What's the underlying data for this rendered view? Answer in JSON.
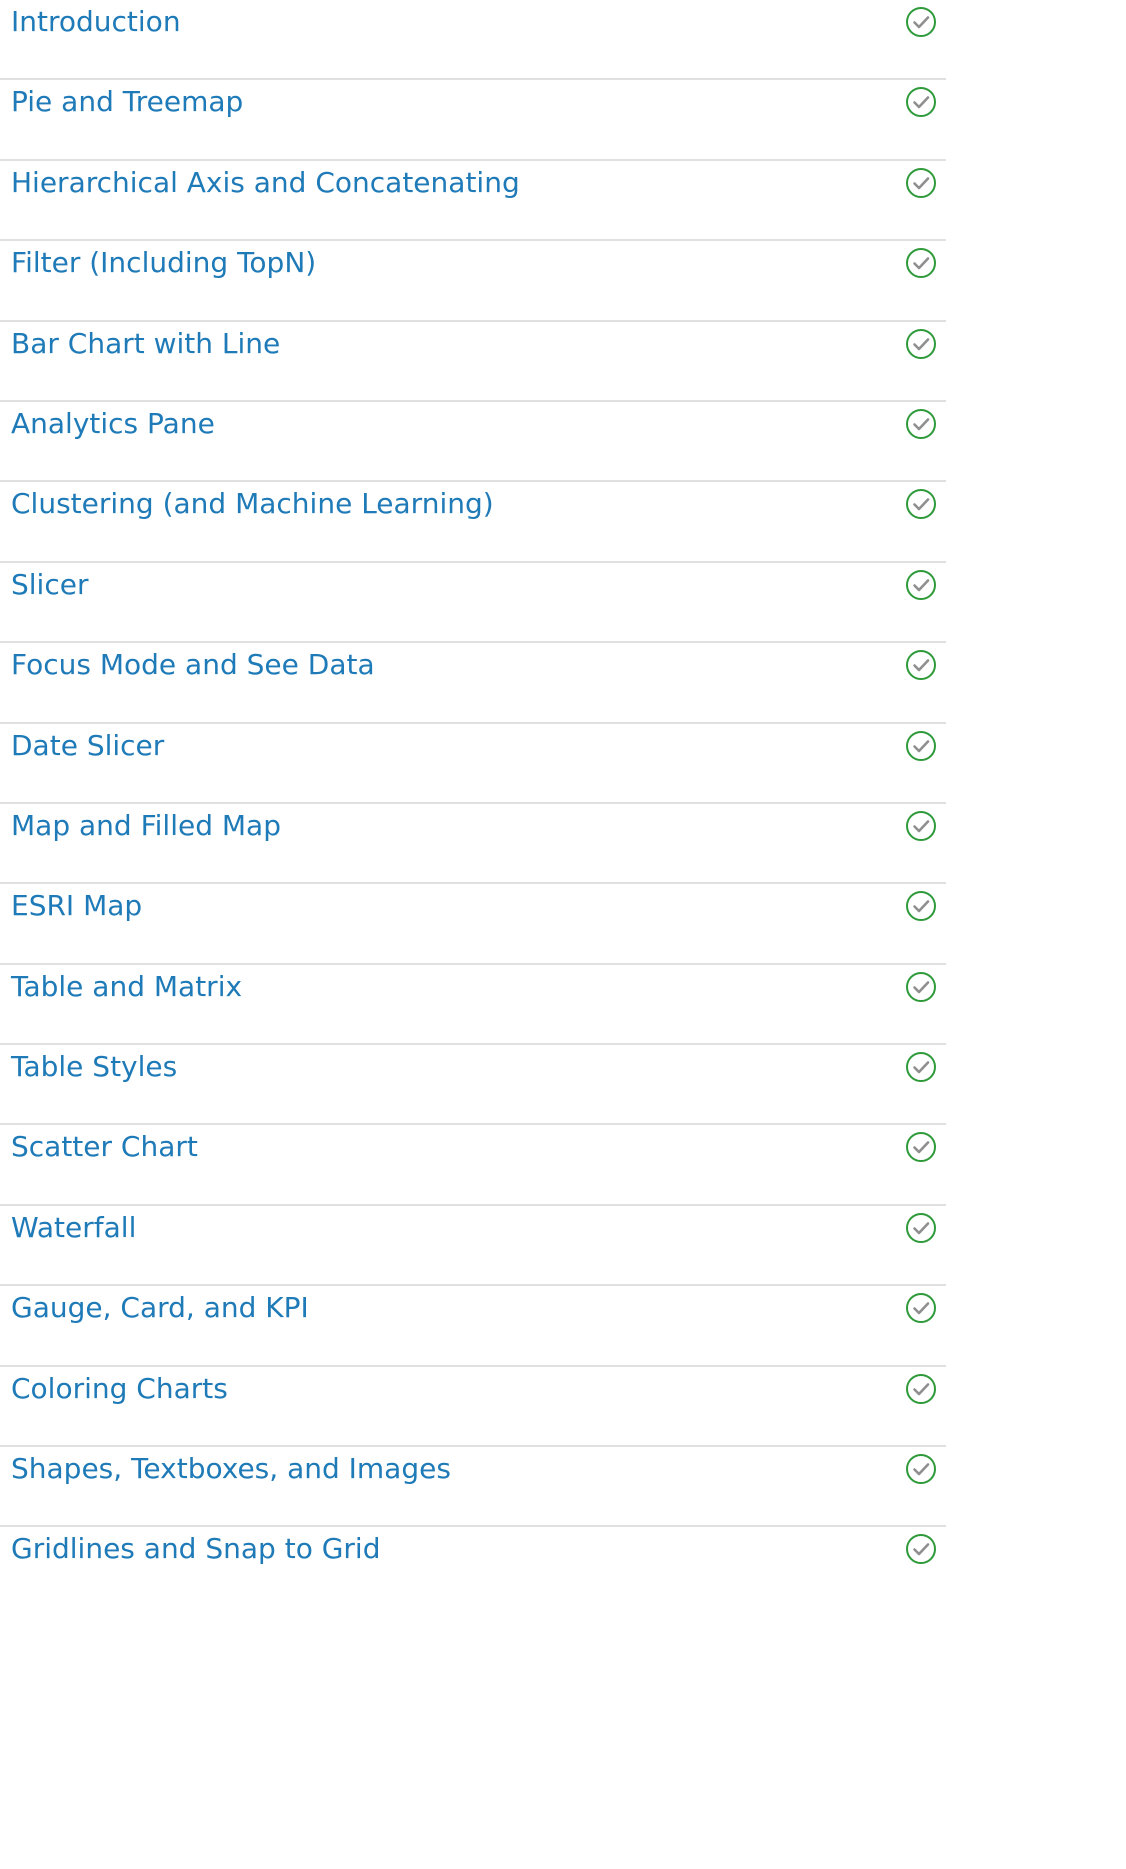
{
  "lessons": [
    {
      "title": "Introduction",
      "status_icon": "check-circle-icon"
    },
    {
      "title": "Pie and Treemap",
      "status_icon": "check-circle-icon"
    },
    {
      "title": "Hierarchical Axis and Concatenating",
      "status_icon": "check-circle-icon"
    },
    {
      "title": "Filter (Including TopN)",
      "status_icon": "check-circle-icon"
    },
    {
      "title": "Bar Chart with Line",
      "status_icon": "check-circle-icon"
    },
    {
      "title": "Analytics Pane",
      "status_icon": "check-circle-icon"
    },
    {
      "title": "Clustering (and Machine Learning)",
      "status_icon": "check-circle-icon"
    },
    {
      "title": "Slicer",
      "status_icon": "check-circle-icon"
    },
    {
      "title": "Focus Mode and See Data",
      "status_icon": "check-circle-icon"
    },
    {
      "title": "Date Slicer",
      "status_icon": "check-circle-icon"
    },
    {
      "title": "Map and Filled Map",
      "status_icon": "check-circle-icon"
    },
    {
      "title": "ESRI Map",
      "status_icon": "check-circle-icon"
    },
    {
      "title": "Table and Matrix",
      "status_icon": "check-circle-icon"
    },
    {
      "title": "Table Styles",
      "status_icon": "check-circle-icon"
    },
    {
      "title": "Scatter Chart",
      "status_icon": "check-circle-icon"
    },
    {
      "title": "Waterfall",
      "status_icon": "check-circle-icon"
    },
    {
      "title": "Gauge, Card, and KPI",
      "status_icon": "check-circle-icon"
    },
    {
      "title": "Coloring Charts",
      "status_icon": "check-circle-icon"
    },
    {
      "title": "Shapes, Textboxes, and Images",
      "status_icon": "check-circle-icon"
    },
    {
      "title": "Gridlines and Snap to Grid",
      "status_icon": "check-circle-icon"
    }
  ],
  "colors": {
    "link": "#1f7ab8",
    "check_ring": "#2e9a3a",
    "check_mark": "#8f8f8f",
    "divider": "#e0e0e0"
  }
}
